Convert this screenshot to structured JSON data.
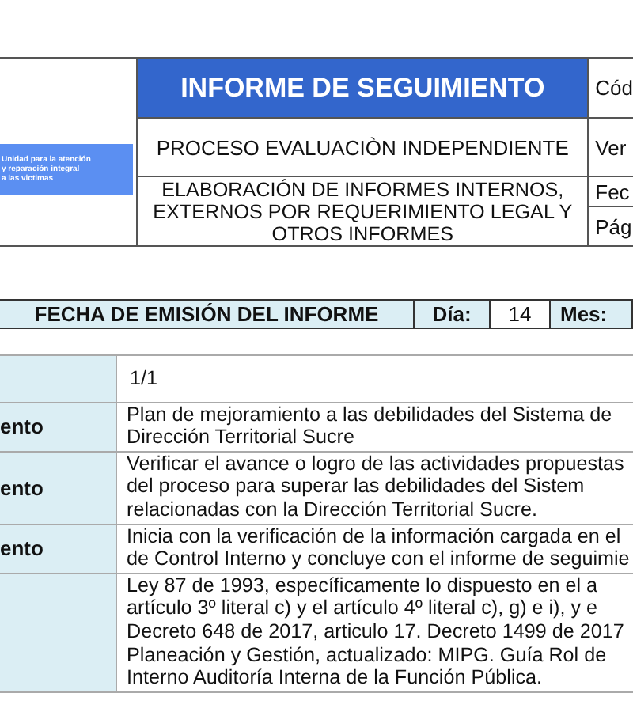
{
  "header": {
    "logo_lines": [
      "Unidad para la atención",
      "y reparación integral",
      "a las victimas"
    ],
    "title": "INFORME DE SEGUIMIENTO",
    "process": "PROCESO EVALUACIÒN INDEPENDIENTE",
    "procedure": "ELABORACIÓN DE INFORMES INTERNOS, EXTERNOS POR REQUERIMIENTO LEGAL Y OTROS INFORMES",
    "side_labels": [
      "Cód",
      "Ver",
      "Fec",
      "Pág"
    ]
  },
  "date_bar": {
    "label": "FECHA DE EMISIÓN DEL INFORME",
    "day_label": "Día:",
    "day": "14",
    "month_label": "Mes:"
  },
  "details": [
    {
      "lines": [
        "1/1"
      ]
    },
    {
      "label": "ento",
      "lines": [
        "Plan de mejoramiento a las debilidades del Sistema de",
        "Dirección Territorial Sucre"
      ]
    },
    {
      "label": "ento",
      "lines": [
        "Verificar el avance o logro de las actividades propuestas",
        "del proceso para superar las debilidades del Sistem",
        "relacionadas con la Dirección Territorial Sucre."
      ]
    },
    {
      "label": "ento",
      "lines": [
        "Inicia con la verificación de la información cargada en el",
        "de Control Interno y concluye con el informe de seguimie"
      ]
    },
    {
      "lines": [
        "Ley 87 de 1993, específicamente lo dispuesto en el a",
        "artículo 3º literal c) y el artículo 4º literal c), g) e i), y e",
        "Decreto 648 de 2017, articulo 17. Decreto 1499 de 2017",
        "Planeación y Gestión, actualizado: MIPG. Guía Rol de",
        "Interno Auditoría Interna de la Función Pública."
      ]
    }
  ]
}
